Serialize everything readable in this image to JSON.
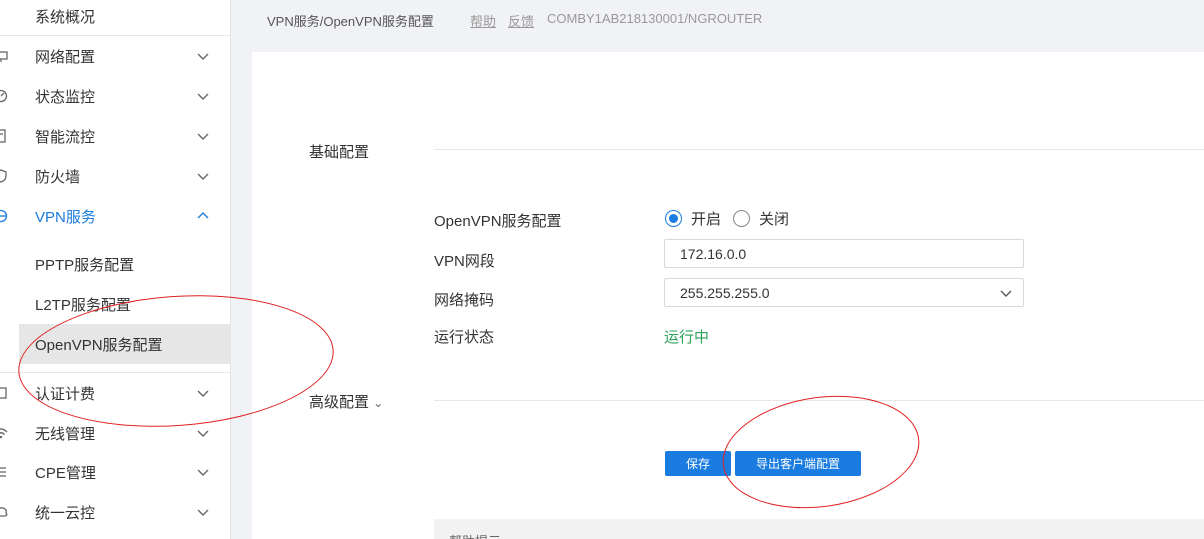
{
  "sidebar": {
    "items": [
      {
        "label": "系统概况",
        "icon": "home-icon"
      },
      {
        "label": "网络配置",
        "icon": "network-icon"
      },
      {
        "label": "状态监控",
        "icon": "monitor-icon"
      },
      {
        "label": "智能流控",
        "icon": "flow-icon"
      },
      {
        "label": "防火墙",
        "icon": "shield-icon"
      },
      {
        "label": "VPN服务",
        "icon": "vpn-icon"
      },
      {
        "label": "认证计费",
        "icon": "auth-icon"
      },
      {
        "label": "无线管理",
        "icon": "wifi-icon"
      },
      {
        "label": "CPE管理",
        "icon": "cpe-icon"
      },
      {
        "label": "统一云控",
        "icon": "cloud-icon"
      }
    ],
    "vpn_sub": [
      {
        "label": "PPTP服务配置"
      },
      {
        "label": "L2TP服务配置"
      },
      {
        "label": "OpenVPN服务配置"
      }
    ]
  },
  "header": {
    "breadcrumb": "VPN服务/OpenVPN服务配置",
    "help": "帮助",
    "feedback": "反馈",
    "device": "COMBY1AB218130001/NGROUTER"
  },
  "main": {
    "basic_title": "基础配置",
    "advanced_title": "高级配置",
    "advanced_arrow": "⌄",
    "fields": {
      "openvpn_label": "OpenVPN服务配置",
      "radio_on": "开启",
      "radio_off": "关闭",
      "radio_selected": "开启",
      "vpn_segment_label": "VPN网段",
      "vpn_segment_value": "172.16.0.0",
      "netmask_label": "网络掩码",
      "netmask_value": "255.255.255.0",
      "status_label": "运行状态",
      "status_value": "运行中"
    },
    "buttons": {
      "save": "保存",
      "export": "导出客户端配置"
    },
    "help_title": "帮助提示:"
  },
  "colors": {
    "accent": "#1a7be0",
    "running": "#2ba35a",
    "annotation": "#e02020"
  }
}
